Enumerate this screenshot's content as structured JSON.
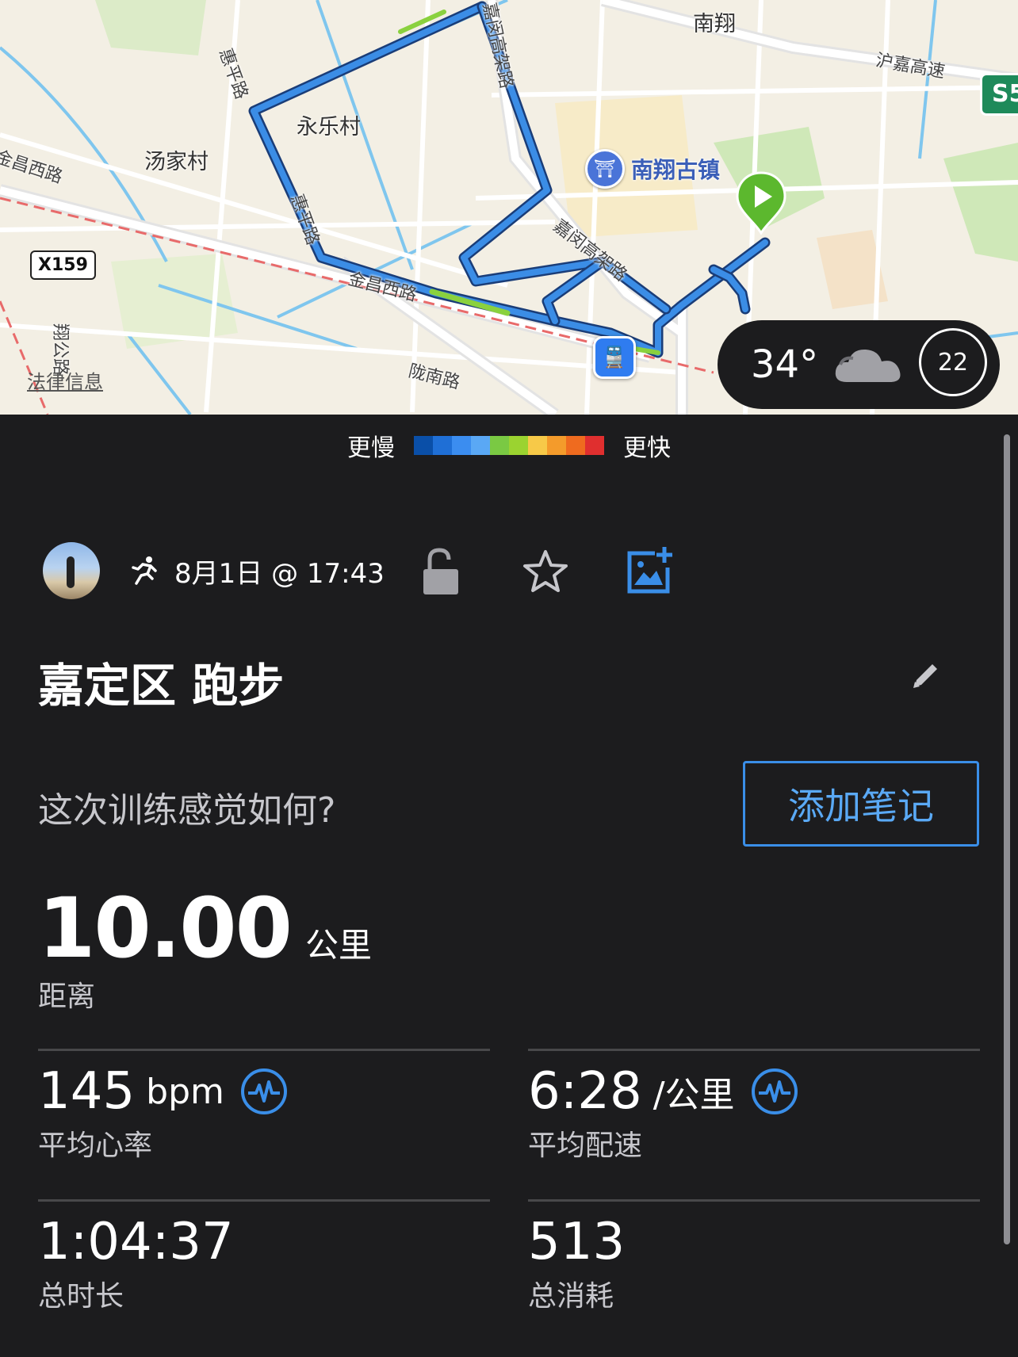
{
  "map": {
    "labels": {
      "nanxiang": "南翔",
      "yongle": "永乐村",
      "tangjia": "汤家村",
      "jinchang_w_left": "金昌西路",
      "jinchang_w": "金昌西路",
      "huiping_top": "惠平路",
      "huiping_mid": "惠平路",
      "jiamin_top": "嘉闵高架路",
      "jiamin_mid": "嘉闵高架路",
      "hujia": "沪嘉高速",
      "longnan": "陇南路",
      "xiangx": "翔公路"
    },
    "poi_town": "南翔古镇",
    "road_badge": "X159",
    "highway_badge": "S5",
    "legal": "法律信息",
    "weather": {
      "temp": "34°",
      "aqi": "22"
    }
  },
  "pace_legend": {
    "slower": "更慢",
    "faster": "更快",
    "colors": [
      "#0a4fa8",
      "#1f6fd6",
      "#3b8df0",
      "#5aa8f5",
      "#7ac943",
      "#9bd330",
      "#f7c948",
      "#f49b2b",
      "#ef6b1f",
      "#e02f2f"
    ]
  },
  "activity": {
    "datetime": "8月1日 @ 17:43",
    "title": "嘉定区 跑步",
    "feel_prompt": "这次训练感觉如何?",
    "add_note": "添加笔记"
  },
  "distance": {
    "value": "10.00",
    "unit": "公里",
    "label": "距离"
  },
  "stats": {
    "hr": {
      "value": "145",
      "unit": "bpm",
      "label": "平均心率"
    },
    "pace": {
      "value": "6:28",
      "unit": "/公里",
      "label": "平均配速"
    },
    "duration": {
      "value": "1:04:37",
      "label": "总时长"
    },
    "calories": {
      "value": "513",
      "label": "总消耗"
    }
  },
  "colors": {
    "accent": "#3a8ee8",
    "background": "#1c1c1e",
    "route": "#2f7ad8"
  }
}
